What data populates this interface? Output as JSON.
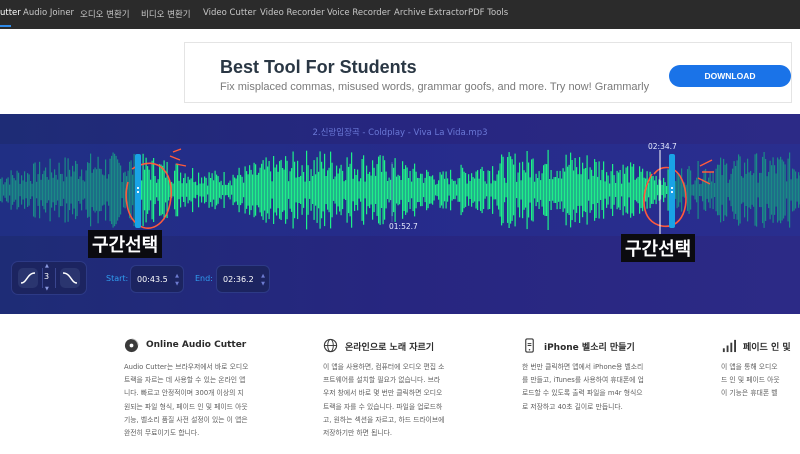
{
  "nav": {
    "items": [
      "Audio Cutter",
      "Audio Joiner",
      "오디오 변환기",
      "비디오 변환기",
      "Video Cutter",
      "Video Recorder",
      "Voice Recorder",
      "Archive Extractor",
      "PDF Tools"
    ],
    "visible_items": [
      "utter",
      "Audio Joiner",
      "오디오 변환기",
      "비디오 변환기",
      "Video Cutter",
      "Video Recorder",
      "Voice Recorder",
      "Archive Extractor",
      "PDF Tools"
    ],
    "active": "Audio Cutter",
    "accent": "#2f8bea"
  },
  "ad": {
    "title": "Best Tool For Students",
    "subtitle": "Fix misplaced commas, misused words, grammar goofs, and more. Try now! Grammarly",
    "button": "DOWNLOAD"
  },
  "editor": {
    "track_name": "2.신랑입장곡 - Coldplay - Viva La Vida.mp3",
    "cursor_time": "01:52.7",
    "end_marker_time": "02:34.7",
    "left_annotation": "구간선택",
    "right_annotation": "구간선택",
    "fade_value": "3",
    "start_label": "Start:",
    "start_value": "00:43.5",
    "end_label": "End:",
    "end_value": "02:36.2",
    "colors": {
      "wave_selected": "#1ef089",
      "wave_unselected": "#1a8a86",
      "handle": "#19a3e6",
      "annotation_circle": "#ff5a3c"
    },
    "icons": [
      "fade-in-icon",
      "fade-out-icon",
      "spin-up-icon",
      "spin-down-icon"
    ]
  },
  "cards": [
    {
      "icon": "music-disc-icon",
      "title": "Online Audio Cutter",
      "lines": [
        "Audio Cutter는 브라우저에서 바로 오디오",
        "트랙을 자르는 데 사용할 수 있는 온라인 앱",
        "니다. 빠르고 안정적이며 300개 이상의 지",
        "원되는 파일 형식, 페이드 인 및 페이드 아웃",
        "기능, 벨소리 품질 사전 설정이 있는 이 앱은",
        "완전히 무료이기도 합니다."
      ]
    },
    {
      "icon": "globe-icon",
      "title": "온라인으로 노래 자르기",
      "lines": [
        "이 앱을 사용하면, 컴퓨터에 오디오 편집 소",
        "프트웨어를 설치할 필요가 없습니다. 브라",
        "우저 창에서 바로 몇 번만 클릭하면 오디오",
        "트랙을 자를 수 있습니다. 파일을 업로드하",
        "고, 원하는 섹션을 자르고, 하드 드라이브에",
        "저장하기만 하면 됩니다."
      ]
    },
    {
      "icon": "iphone-icon",
      "title": "iPhone 벨소리 만들기",
      "lines": [
        "한 번만 클릭하면 앱에서 iPhone용 벨소리",
        "를 만들고, iTunes를 사용하여 휴대폰에 업",
        "로드할 수 있도록 출력 파일을 m4r 형식으",
        "로 저장하고 40초 길이로 만듭니다."
      ]
    },
    {
      "icon": "signal-bars-icon",
      "title": "페이드 인 및",
      "lines": [
        "이 앱을 통해 오디오",
        "드 인 및 페이드 아웃",
        "이 기능은 휴대폰 벨"
      ]
    }
  ]
}
